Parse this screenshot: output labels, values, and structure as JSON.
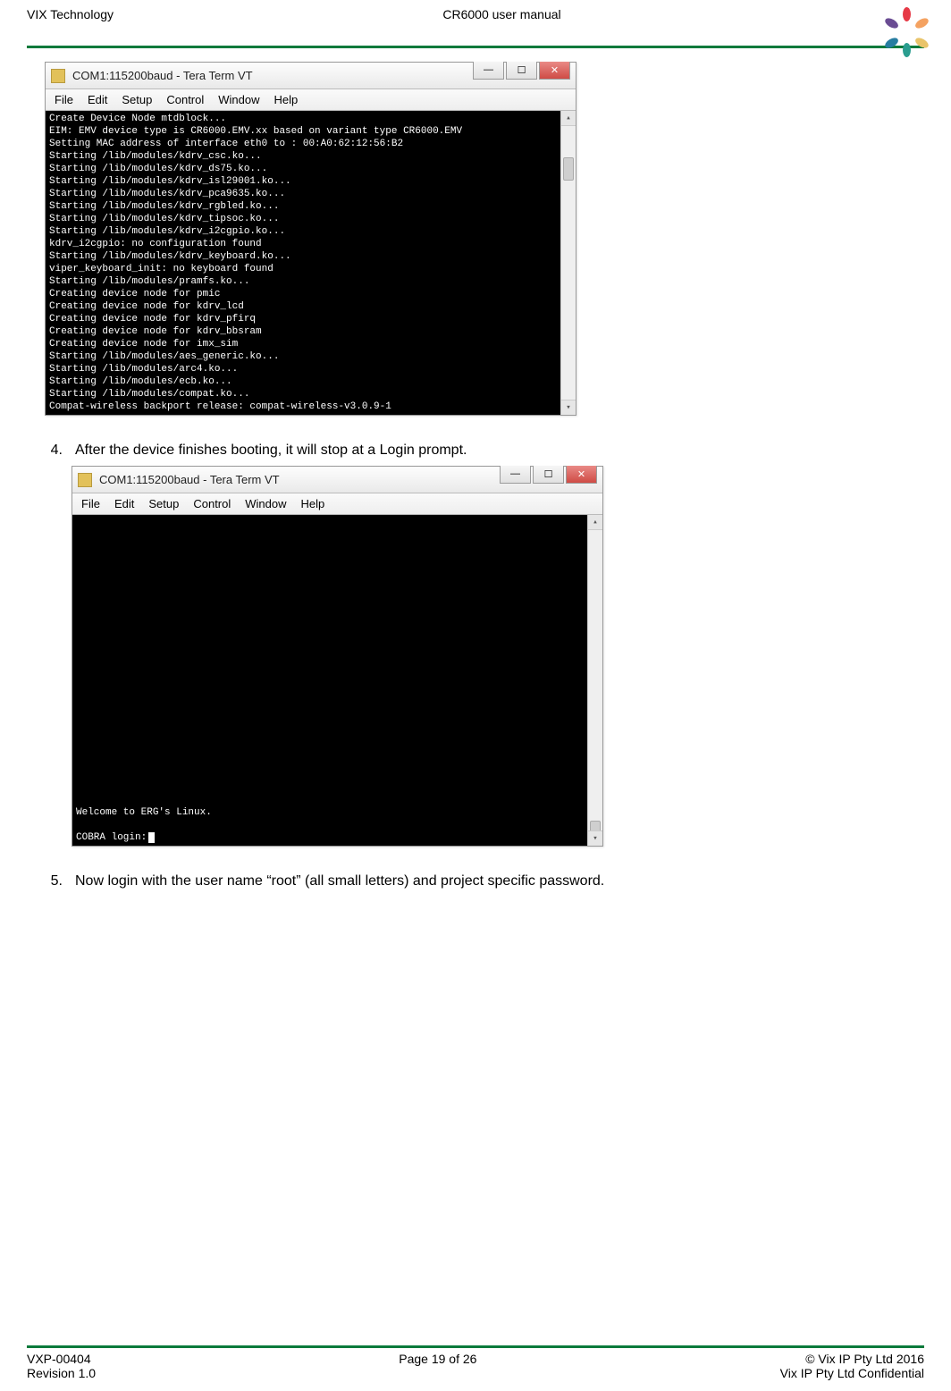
{
  "header": {
    "left": "VIX Technology",
    "center": "CR6000 user manual"
  },
  "terminal1": {
    "title": "COM1:115200baud - Tera Term VT",
    "menu": [
      "File",
      "Edit",
      "Setup",
      "Control",
      "Window",
      "Help"
    ],
    "lines": [
      "Create Device Node mtdblock...",
      "EIM: EMV device type is CR6000.EMV.xx based on variant type CR6000.EMV",
      "Setting MAC address of interface eth0 to : 00:A0:62:12:56:B2",
      "Starting /lib/modules/kdrv_csc.ko...",
      "Starting /lib/modules/kdrv_ds75.ko...",
      "Starting /lib/modules/kdrv_isl29001.ko...",
      "Starting /lib/modules/kdrv_pca9635.ko...",
      "Starting /lib/modules/kdrv_rgbled.ko...",
      "Starting /lib/modules/kdrv_tipsoc.ko...",
      "Starting /lib/modules/kdrv_i2cgpio.ko...",
      "kdrv_i2cgpio: no configuration found",
      "Starting /lib/modules/kdrv_keyboard.ko...",
      "viper_keyboard_init: no keyboard found",
      "Starting /lib/modules/pramfs.ko...",
      "Creating device node for pmic",
      "Creating device node for kdrv_lcd",
      "Creating device node for kdrv_pfirq",
      "Creating device node for kdrv_bbsram",
      "Creating device node for imx_sim",
      "Starting /lib/modules/aes_generic.ko...",
      "Starting /lib/modules/arc4.ko...",
      "Starting /lib/modules/ecb.ko...",
      "Starting /lib/modules/compat.ko...",
      "Compat-wireless backport release: compat-wireless-v3.0.9-1"
    ]
  },
  "step4": {
    "num": "4.",
    "text": "After the device finishes booting, it will stop at a Login prompt."
  },
  "terminal2": {
    "title": "COM1:115200baud - Tera Term VT",
    "menu": [
      "File",
      "Edit",
      "Setup",
      "Control",
      "Window",
      "Help"
    ],
    "welcome": "Welcome to ERG's Linux.",
    "prompt": "COBRA login:"
  },
  "step5": {
    "num": "5.",
    "text": "Now login with the user name “root” (all small letters) and project specific password."
  },
  "footer": {
    "left1": "VXP-00404",
    "left2": "Revision 1.0",
    "center": "Page 19 of 26",
    "right1": "© Vix IP Pty Ltd  2016",
    "right2": "Vix IP Pty Ltd  Confidential"
  }
}
